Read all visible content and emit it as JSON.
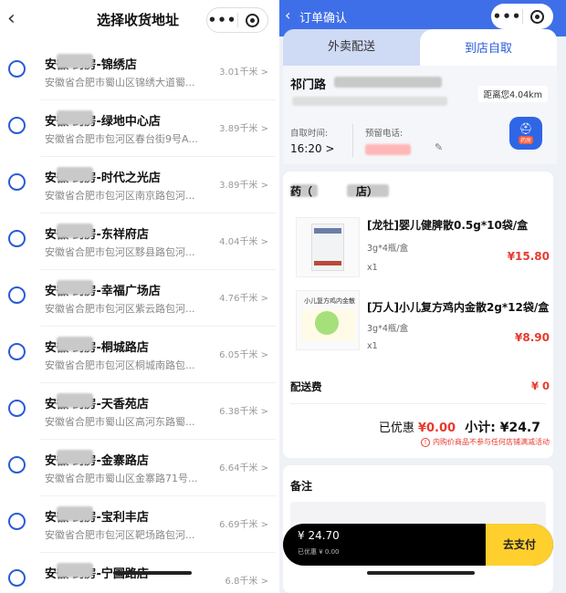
{
  "left": {
    "title": "选择收货地址",
    "stores": [
      {
        "name": "安徽 药房-锦绣店",
        "address": "安徽省合肥市蜀山区锦绣大道蜀...",
        "distance": "3.01千米 >"
      },
      {
        "name": "安徽 药房-绿地中心店",
        "address": "安徽省合肥市包河区春台街9号A...",
        "distance": "3.89千米 >"
      },
      {
        "name": "安徽 药房-时代之光店",
        "address": "安徽省合肥市包河区南京路包河...",
        "distance": "3.89千米 >"
      },
      {
        "name": "安徽 药房-东祥府店",
        "address": "安徽省合肥市包河区黟县路包河...",
        "distance": "4.04千米 >"
      },
      {
        "name": "安徽 药房-幸福广场店",
        "address": "安徽省合肥市包河区紫云路包河...",
        "distance": "4.76千米 >"
      },
      {
        "name": "安徽 药房-桐城路店",
        "address": "安徽省合肥市包河区桐城南路包...",
        "distance": "6.05千米 >"
      },
      {
        "name": "安徽 药房-天香苑店",
        "address": "安徽省合肥市蜀山区高河东路蜀...",
        "distance": "6.38千米 >"
      },
      {
        "name": "安徽 药房-金寨路店",
        "address": "安徽省合肥市蜀山区金寨路71号...",
        "distance": "6.64千米 >"
      },
      {
        "name": "安徽 药房-宝利丰店",
        "address": "安徽省合肥市包河区靶场路包河...",
        "distance": "6.69千米 >"
      },
      {
        "name": "安徽 药房-宁国路店",
        "address": "",
        "distance": "6.8千米 >"
      }
    ]
  },
  "right": {
    "title": "订单确认",
    "tabs": {
      "delivery": "外卖配送",
      "pickup": "到店自取"
    },
    "address": {
      "main": "祁门路",
      "distance": "距离您4.04km"
    },
    "pickup_time_label": "自取时间:",
    "pickup_time": "16:20 >",
    "phone_label": "预留电话:",
    "shop_badge": "药房",
    "shop_name": "药（　　　　店）",
    "products": [
      {
        "title": "[龙牡]婴儿健脾散0.5g*10袋/盒",
        "spec": "3g*4瓶/盒",
        "qty": "x1",
        "price": "¥15.80"
      },
      {
        "title": "[万人]小儿复方鸡内金散2g*12袋/盒",
        "spec": "3g*4瓶/盒",
        "qty": "x1",
        "price": "¥8.90",
        "img_text": "小儿复方鸡内金散"
      }
    ],
    "delivery_fee_label": "配送费",
    "delivery_fee": "¥ 0",
    "discount_label": "已优惠",
    "discount": "¥0.00",
    "subtotal": "小计: ¥24.7",
    "promo_note": "内购价商品不参与任何店铺满减活动",
    "remark_label": "备注",
    "pay": {
      "amount": "¥ 24.70",
      "discount": "已优惠 ¥ 0.00",
      "button": "去支付"
    }
  },
  "colors": {
    "accent": "#3f6fe8",
    "price_red": "#e63a2e",
    "pay_yellow": "#ffcf2e",
    "radio_blue": "#2a5bd7"
  }
}
